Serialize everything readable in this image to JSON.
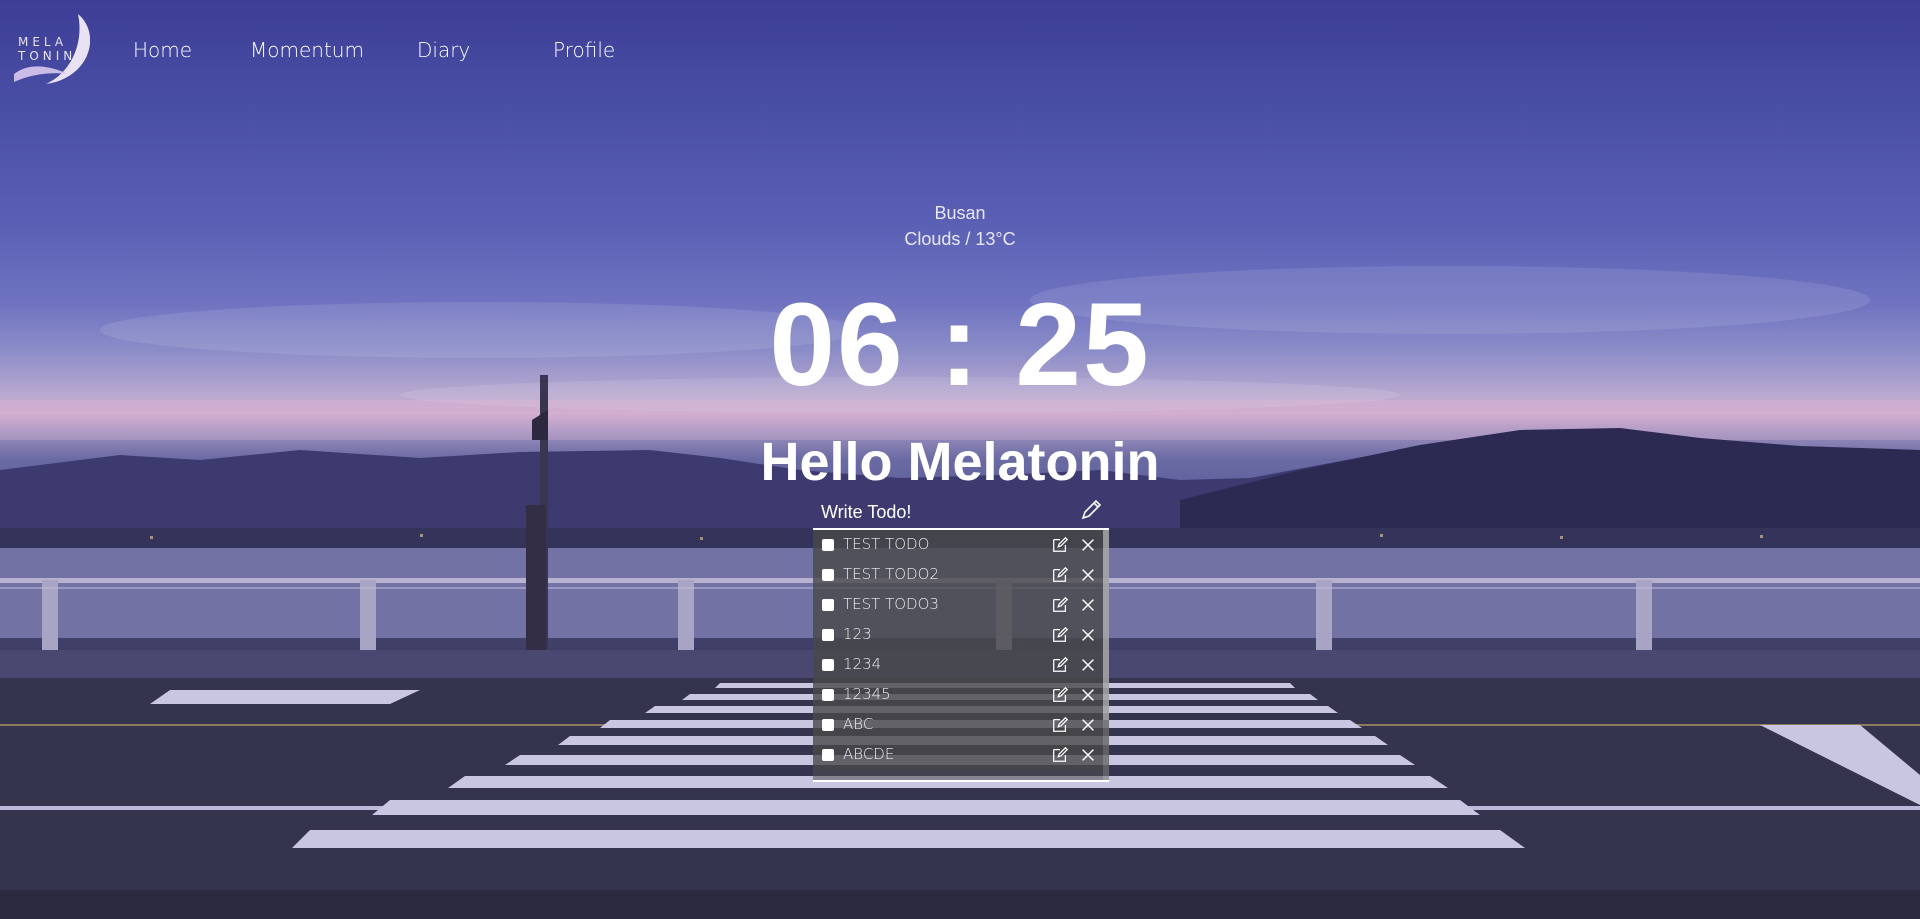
{
  "nav": {
    "logo_text_line1": "MELA",
    "logo_text_line2": "TONIN",
    "items": [
      {
        "label": "Home"
      },
      {
        "label": "Momentum"
      },
      {
        "label": "Diary"
      },
      {
        "label": "Profile"
      }
    ]
  },
  "weather": {
    "city": "Busan",
    "condition": "Clouds / 13°C"
  },
  "clock": {
    "time": "06 : 25"
  },
  "greeting": {
    "text": "Hello Melatonin"
  },
  "todo": {
    "placeholder": "Write Todo!",
    "items": [
      {
        "text": "TEST TODO"
      },
      {
        "text": "TEST TODO2"
      },
      {
        "text": "TEST TODO3"
      },
      {
        "text": "123"
      },
      {
        "text": "1234"
      },
      {
        "text": "12345"
      },
      {
        "text": "ABC"
      },
      {
        "text": "ABCDE"
      }
    ]
  },
  "icons": {
    "submit": "pencil-icon",
    "edit": "edit-icon",
    "delete": "close-icon"
  }
}
